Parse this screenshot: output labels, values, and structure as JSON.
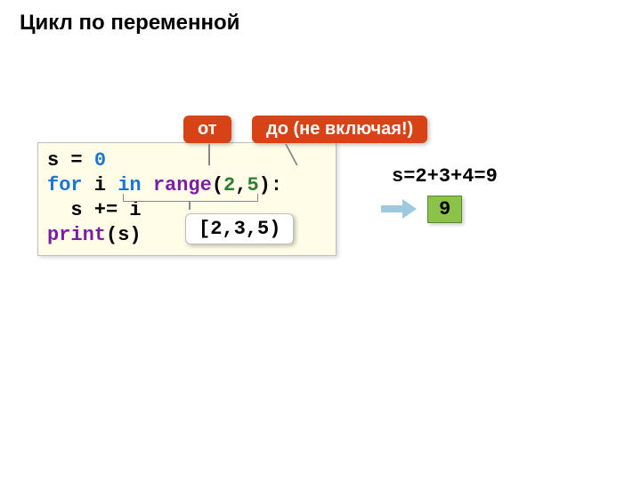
{
  "title": "Цикл по переменной",
  "code": {
    "line1_pre": "s = ",
    "line1_val": "0",
    "line2_kw": "for",
    "line2_mid": " i ",
    "line2_in": "in",
    "line2_sp": " ",
    "line2_range": "range",
    "line2_open": "(",
    "line2_a": "2",
    "line2_comma": ",",
    "line2_b": "5",
    "line2_close": "):",
    "line3": "  s += i",
    "line4_print": "print",
    "line4_arg": "(s)"
  },
  "callouts": {
    "from": "от",
    "to": "до (не включая!)",
    "interval": "[2,3,5)"
  },
  "sum_text": "s=2+3+4=9",
  "result": "9"
}
